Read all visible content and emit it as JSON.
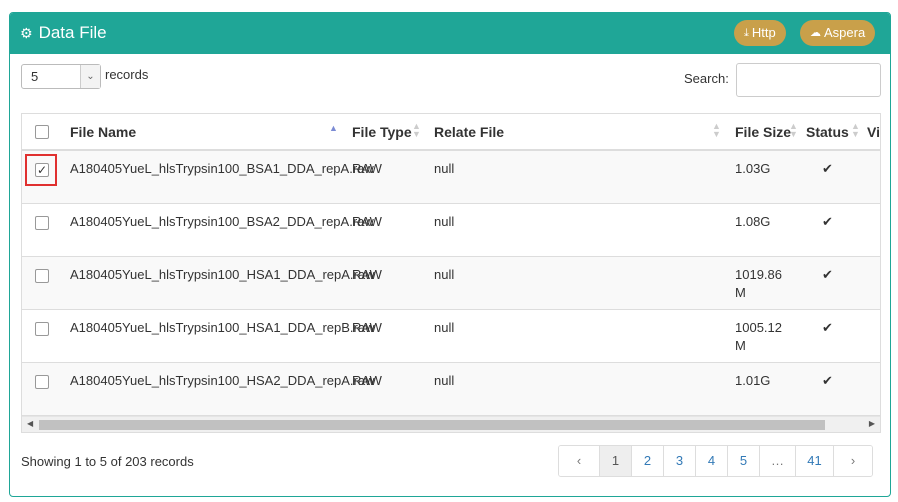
{
  "header": {
    "title": "Data File",
    "title_icon": "gears-icon",
    "http_label": "Http",
    "aspera_label": "Aspera",
    "accent": "#1fa697",
    "button_color": "#c9a04a"
  },
  "length": {
    "value": "5",
    "label": "records"
  },
  "search": {
    "label": "Search:",
    "value": "",
    "placeholder": ""
  },
  "table": {
    "columns": [
      "File Name",
      "File Type",
      "Relate File",
      "File Size",
      "Status",
      "Vi"
    ],
    "rows": [
      {
        "checked": true,
        "name": "A180405YueL_hlsTrypsin100_BSA1_DDA_repA.raw",
        "type": "RAW",
        "relate": "null",
        "size": "1.03G",
        "status": "✔"
      },
      {
        "checked": false,
        "name": "A180405YueL_hlsTrypsin100_BSA2_DDA_repA.raw",
        "type": "RAW",
        "relate": "null",
        "size": "1.08G",
        "status": "✔"
      },
      {
        "checked": false,
        "name": "A180405YueL_hlsTrypsin100_HSA1_DDA_repA.raw",
        "type": "RAW",
        "relate": "null",
        "size": "1019.86 M",
        "status": "✔"
      },
      {
        "checked": false,
        "name": "A180405YueL_hlsTrypsin100_HSA1_DDA_repB.raw",
        "type": "RAW",
        "relate": "null",
        "size": "1005.12 M",
        "status": "✔"
      },
      {
        "checked": false,
        "name": "A180405YueL_hlsTrypsin100_HSA2_DDA_repA.raw",
        "type": "RAW",
        "relate": "null",
        "size": "1.01G",
        "status": "✔"
      }
    ]
  },
  "info": "Showing 1 to 5 of 203 records",
  "pagination": {
    "prev": "‹",
    "pages": [
      "1",
      "2",
      "3",
      "4",
      "5",
      "…",
      "41"
    ],
    "next": "›",
    "active": "1"
  }
}
